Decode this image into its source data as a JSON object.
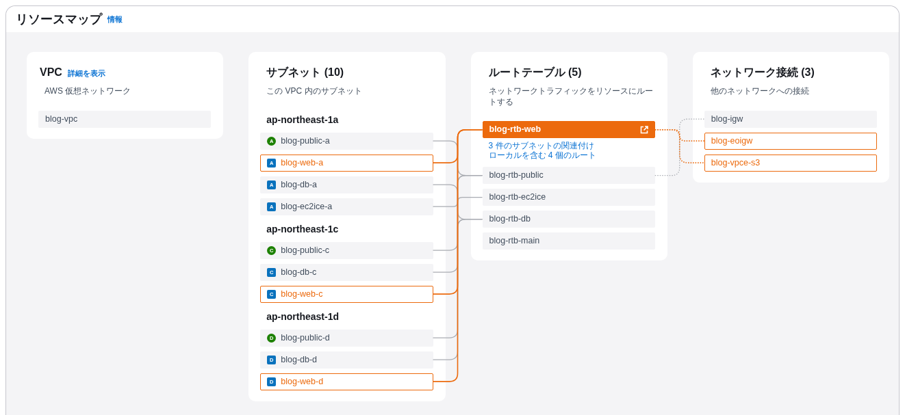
{
  "title": "リソースマップ",
  "info_link": "情報",
  "vpc": {
    "title": "VPC",
    "link": "詳細を表示",
    "description": "AWS 仮想ネットワーク",
    "items": [
      {
        "name": "blog-vpc"
      }
    ]
  },
  "subnets": {
    "title": "サブネット (10)",
    "description": "この VPC 内のサブネット",
    "groups": [
      {
        "zone": "ap-northeast-1a",
        "items": [
          {
            "name": "blog-public-a",
            "badge": "A",
            "kind": "public",
            "highlighted": false
          },
          {
            "name": "blog-web-a",
            "badge": "A",
            "kind": "web",
            "highlighted": true
          },
          {
            "name": "blog-db-a",
            "badge": "A",
            "kind": "db",
            "highlighted": false
          },
          {
            "name": "blog-ec2ice-a",
            "badge": "A",
            "kind": "ec2ice",
            "highlighted": false
          }
        ]
      },
      {
        "zone": "ap-northeast-1c",
        "items": [
          {
            "name": "blog-public-c",
            "badge": "C",
            "kind": "public",
            "highlighted": false
          },
          {
            "name": "blog-db-c",
            "badge": "C",
            "kind": "db",
            "highlighted": false
          },
          {
            "name": "blog-web-c",
            "badge": "C",
            "kind": "web",
            "highlighted": true
          }
        ]
      },
      {
        "zone": "ap-northeast-1d",
        "items": [
          {
            "name": "blog-public-d",
            "badge": "D",
            "kind": "public",
            "highlighted": false
          },
          {
            "name": "blog-db-d",
            "badge": "D",
            "kind": "db",
            "highlighted": false
          },
          {
            "name": "blog-web-d",
            "badge": "D",
            "kind": "web",
            "highlighted": true
          }
        ]
      }
    ]
  },
  "route_tables": {
    "title": "ルートテーブル (5)",
    "description": "ネットワークトラフィックをリソースにルートする",
    "items": [
      {
        "name": "blog-rtb-web",
        "kind": "web",
        "selected": true,
        "details": [
          "3 件のサブネットの関連付け",
          "ローカルを含む 4 個のルート"
        ]
      },
      {
        "name": "blog-rtb-public",
        "kind": "public",
        "selected": false
      },
      {
        "name": "blog-rtb-ec2ice",
        "kind": "ec2ice",
        "selected": false
      },
      {
        "name": "blog-rtb-db",
        "kind": "db",
        "selected": false
      },
      {
        "name": "blog-rtb-main",
        "kind": "main",
        "selected": false
      }
    ]
  },
  "network_connections": {
    "title": "ネットワーク接続 (3)",
    "description": "他のネットワークへの接続",
    "items": [
      {
        "name": "blog-igw",
        "kind": "public",
        "highlighted": false
      },
      {
        "name": "blog-eoigw",
        "kind": "web",
        "highlighted": true
      },
      {
        "name": "blog-vpce-s3",
        "kind": "web",
        "highlighted": true
      }
    ]
  }
}
